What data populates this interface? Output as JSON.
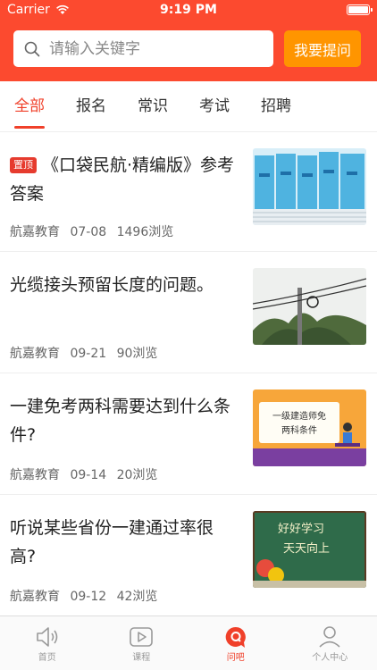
{
  "status_bar": {
    "carrier": "Carrier",
    "time": "9:19 PM"
  },
  "search": {
    "placeholder": "请输入关键字",
    "ask_label": "我要提问"
  },
  "tabs": [
    {
      "label": "全部",
      "active": true
    },
    {
      "label": "报名",
      "active": false
    },
    {
      "label": "常识",
      "active": false
    },
    {
      "label": "考试",
      "active": false
    },
    {
      "label": "招聘",
      "active": false
    }
  ],
  "articles": [
    {
      "badge": "置顶",
      "title": "《口袋民航·精编版》参考答案",
      "source": "航嘉教育",
      "date": "07-08",
      "views": "1496浏览",
      "thumb": "books"
    },
    {
      "title": "光缆接头预留长度的问题。",
      "source": "航嘉教育",
      "date": "09-21",
      "views": "90浏览",
      "thumb": "cable-pole"
    },
    {
      "title": "一建免考两科需要达到什么条件?",
      "source": "航嘉教育",
      "date": "09-14",
      "views": "20浏览",
      "thumb": "exam-card",
      "thumb_text_1": "一级建造师免",
      "thumb_text_2": "两科条件"
    },
    {
      "title": "听说某些省份一建通过率很高?",
      "source": "航嘉教育",
      "date": "09-12",
      "views": "42浏览",
      "thumb": "chalkboard",
      "thumb_text_1": "好好学习",
      "thumb_text_2": "天天向上"
    }
  ],
  "tabbar": [
    {
      "label": "首页",
      "icon": "speaker-icon",
      "active": false
    },
    {
      "label": "课程",
      "icon": "play-icon",
      "active": false
    },
    {
      "label": "问吧",
      "icon": "q-bubble-icon",
      "active": true
    },
    {
      "label": "个人中心",
      "icon": "person-icon",
      "active": false
    }
  ],
  "colors": {
    "brand": "#fc4a2f",
    "accent": "#ff9500",
    "active_tab": "#f0402a"
  }
}
